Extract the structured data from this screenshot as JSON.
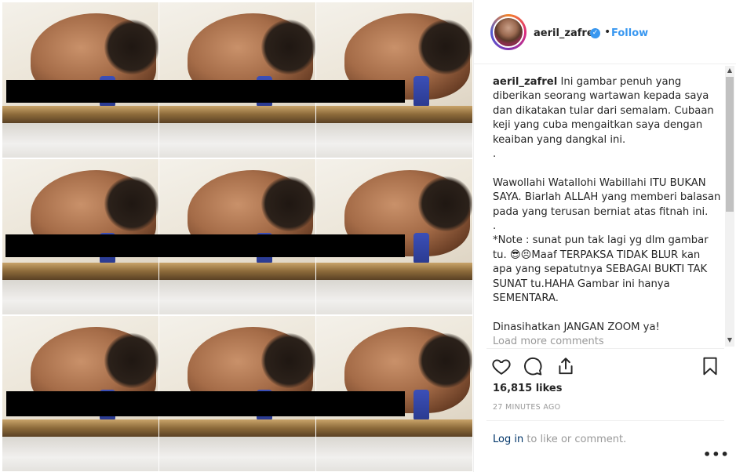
{
  "post": {
    "username": "aeril_zafrel",
    "follow_label": "Follow",
    "separator": "•",
    "verified_icon": "verified-badge-icon"
  },
  "caption": {
    "username": "aeril_zafrel",
    "text": "Ini gambar penuh yang diberikan seorang wartawan kepada saya dan dikatakan tular dari semalam. Cubaan keji yang cuba mengaitkan saya dengan keaiban yang dangkal ini.\n.\n\nWawollahi Watallohi Wabillahi ITU BUKAN SAYA. Biarlah ALLAH yang memberi balasan pada yang terusan berniat atas fitnah ini.\n.\n*Note : sunat pun tak lagi yg dlm gambar tu. 😎😣Maaf TERPAKSA TIDAK BLUR kan apa yang sepatutnya SEBAGAI BUKTI TAK SUNAT tu.HAHA Gambar ini hanya SEMENTARA.\n\nDinasihatkan JANGAN ZOOM ya!"
  },
  "comments": {
    "load_more_label": "Load more comments"
  },
  "actions": {
    "icons": [
      "heart-icon",
      "comment-icon",
      "share-icon",
      "bookmark-icon"
    ]
  },
  "stats": {
    "likes": "16,815 likes",
    "posted_time": "27 MINUTES AGO"
  },
  "footer": {
    "login_link": "Log in",
    "login_suffix": " to like or comment.",
    "more_label": "•••"
  },
  "colors": {
    "accent": "#3897f0",
    "link_dark": "#003569",
    "muted": "#999999",
    "censor_bar": "#000000"
  }
}
